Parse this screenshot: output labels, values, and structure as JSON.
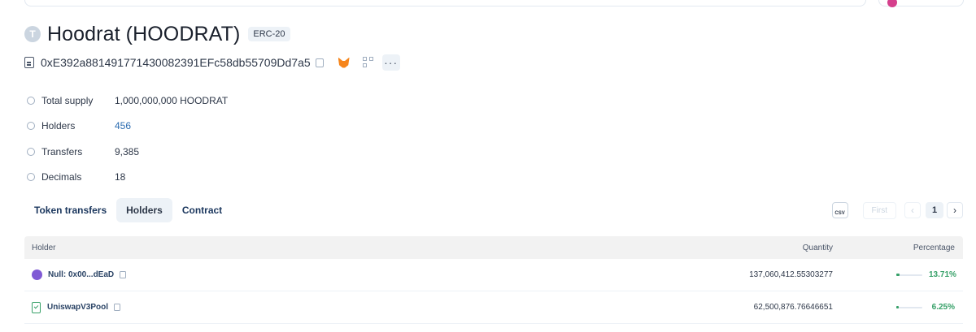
{
  "token": {
    "icon_letter": "T",
    "title": "Hoodrat (HOODRAT)",
    "standard": "ERC-20",
    "address": "0xE392a881491771430082391EFc58db55709Dd7a5",
    "more_label": "···"
  },
  "details": [
    {
      "label": "Total supply",
      "value": "1,000,000,000 HOODRAT",
      "link": false
    },
    {
      "label": "Holders",
      "value": "456",
      "link": true
    },
    {
      "label": "Transfers",
      "value": "9,385",
      "link": false
    },
    {
      "label": "Decimals",
      "value": "18",
      "link": false
    }
  ],
  "tabs": [
    {
      "label": "Token transfers",
      "active": false
    },
    {
      "label": "Holders",
      "active": true
    },
    {
      "label": "Contract",
      "active": false
    }
  ],
  "pagination": {
    "csv_label": "CSV",
    "first_label": "First",
    "prev_label": "‹",
    "current_page": "1",
    "next_label": "›"
  },
  "table": {
    "headers": {
      "holder": "Holder",
      "quantity": "Quantity",
      "percentage": "Percentage"
    },
    "rows": [
      {
        "holder": "Null: 0x00...dEaD",
        "type": "address",
        "quantity": "137,060,412.55303277",
        "percentage": "13.71%",
        "share": 0.1371
      },
      {
        "holder": "UniswapV3Pool",
        "type": "contract",
        "quantity": "62,500,876.76646651",
        "percentage": "6.25%",
        "share": 0.0625
      }
    ]
  },
  "colors": {
    "accent_green": "#38a169",
    "link_blue": "#2b6cb0",
    "fox_orange": "#f6851b"
  }
}
